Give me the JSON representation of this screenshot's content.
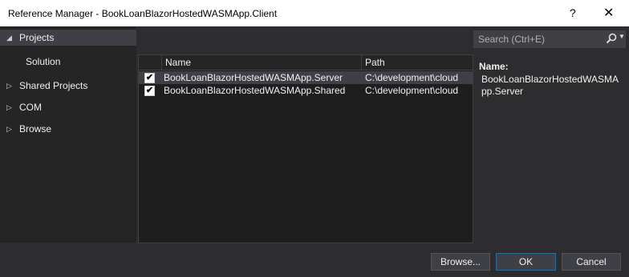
{
  "window": {
    "title": "Reference Manager - BookLoanBlazorHostedWASMApp.Client",
    "help_glyph": "?",
    "close_glyph": "✕"
  },
  "sidebar": {
    "items": [
      {
        "label": "Projects",
        "expanded": true,
        "selected": true
      },
      {
        "label": "Solution",
        "child": true
      },
      {
        "label": "Shared Projects",
        "expanded": false
      },
      {
        "label": "COM",
        "expanded": false
      },
      {
        "label": "Browse",
        "expanded": false
      }
    ],
    "expanded_arrow": "◢",
    "collapsed_arrow": "▷"
  },
  "search": {
    "placeholder": "Search (Ctrl+E)",
    "icon": "search-icon"
  },
  "table": {
    "columns": [
      "Name",
      "Path"
    ],
    "rows": [
      {
        "checked": true,
        "name": "BookLoanBlazorHostedWASMApp.Server",
        "path": "C:\\development\\cloud",
        "selected": true
      },
      {
        "checked": true,
        "name": "BookLoanBlazorHostedWASMApp.Shared",
        "path": "C:\\development\\cloud",
        "selected": false
      }
    ]
  },
  "details": {
    "label": "Name:",
    "value": "BookLoanBlazorHostedWASMApp.Server"
  },
  "buttons": {
    "browse": "Browse...",
    "ok": "OK",
    "cancel": "Cancel"
  },
  "colors": {
    "dialog_bg": "#2d2d30",
    "panel_bg": "#1e1e1e",
    "selected_bg": "#3f3f46",
    "accent": "#007acc"
  }
}
